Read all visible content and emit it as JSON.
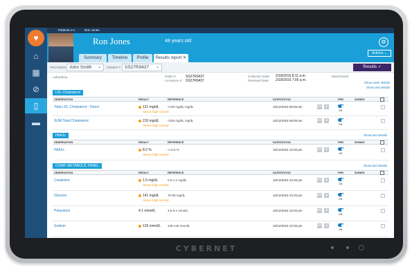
{
  "device": {
    "brand": "CYBERNET"
  },
  "breadcrumb": {
    "left": "Patients ⟷",
    "right": "Ron Jones"
  },
  "patient": {
    "name": "Ron Jones",
    "age": "48 years old"
  },
  "tabs": [
    "Summary",
    "Timeline",
    "Profile",
    "Results report ✕"
  ],
  "header": {
    "actions_label": "Actions ⌄",
    "settings_icon": "gear-icon"
  },
  "provider_bar": {
    "provider_label": "PROVIDER",
    "provider_value": "John Smith",
    "order_label": "ORDER #",
    "order_value": "SS27R9437",
    "results_button": "Results ✓"
  },
  "order_info": {
    "lab": "Laboratory",
    "order_label": "Order #:",
    "order_value": "SS27R9437",
    "accession_label": "Accession #:",
    "accession_value": "SS27R9437",
    "collection_label": "Collection Date:",
    "collection_value": "2/18/2016 8:11 a.m.",
    "received_label": "Received Date:",
    "received_value": "2/18/2016 7:05 a.m.",
    "attachments_label": "Attachments:",
    "show_order_details": "Show order details",
    "show_test_details": "Show test details"
  },
  "columns": {
    "observation": "OBSERVATION",
    "result": "RESULT",
    "reference": "REFERENCE",
    "date_status": "DATE/STATUS",
    "phr": "PHR",
    "signed": "SIGNED"
  },
  "sections": [
    {
      "title": "LDL Cholesterol",
      "link": "",
      "rows": [
        {
          "observation": "Total LDL Cholesterol - Direct",
          "result": "121 mg/dL",
          "flag": "Above high normal",
          "reference": "<130 mg/dL mg/dL",
          "date": "10/12/2015 08:09 am",
          "phr": "ON"
        },
        {
          "observation": "SUM Total Cholesterol",
          "result": "210 mg/dL",
          "flag": "Above high normal",
          "reference": "<200 mg/dL mg/dL",
          "date": "10/12/2015 08:09 am",
          "phr": "ON"
        }
      ]
    },
    {
      "title": "HbA1c",
      "link": "Show test details",
      "rows": [
        {
          "observation": "HbA1c",
          "result": "8.2 %",
          "flag": "Above high normal",
          "reference": "<=5.6 %",
          "date": "10/12/2015 10:45 pm",
          "phr": "ON"
        }
      ]
    },
    {
      "title": "COMP. METABOLIC PANEL",
      "link": "Show test details",
      "rows": [
        {
          "observation": "Creatinine",
          "result": "1.5 mg/dL",
          "flag": "Above high normal",
          "reference": "0.6-1.1 mg/dL",
          "date": "10/12/2015 10:45 pm",
          "phr": "ON"
        },
        {
          "observation": "Glucose",
          "result": "141 mg/dL",
          "flag": "Above high normal",
          "reference": "70-99 mg/dL",
          "date": "10/12/2015 10:45 pm",
          "phr": "ON"
        },
        {
          "observation": "Potassium",
          "result": "4.1 mmol/L",
          "flag": "",
          "reference": "3.5-5.1 mmol/L",
          "date": "10/12/2015 10:45 pm",
          "phr": "ON"
        },
        {
          "observation": "Sodium",
          "result": "133 mmol/L",
          "flag": "",
          "reference": "136-145 mmol/L",
          "date": "10/12/2015 10:45 pm",
          "phr": "ON"
        }
      ]
    }
  ],
  "mini_buttons": [
    "REF",
    "▤"
  ],
  "colors": {
    "accent": "#1a9fd8",
    "sidebar": "#1f4e79",
    "results_button": "#3d2466",
    "flag": "#f39c12"
  }
}
